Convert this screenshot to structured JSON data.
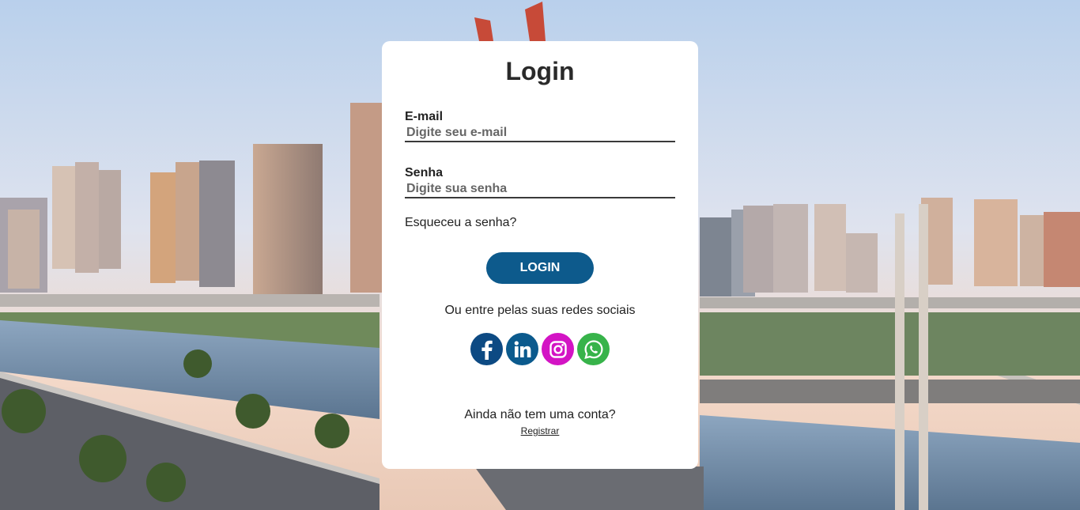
{
  "login": {
    "title": "Login",
    "email_label": "E-mail",
    "email_placeholder": "Digite seu e-mail",
    "password_label": "Senha",
    "password_placeholder": "Digite sua senha",
    "forgot_label": "Esqueceu a senha?",
    "submit_label": "LOGIN",
    "social_text": "Ou entre pelas suas redes sociais",
    "social": [
      {
        "icon": "facebook-icon",
        "color": "#0d4a83"
      },
      {
        "icon": "linkedin-icon",
        "color": "#0b5a8d"
      },
      {
        "icon": "instagram-icon",
        "color": "#d314c4"
      },
      {
        "icon": "whatsapp-icon",
        "color": "#37b34a"
      }
    ],
    "no_account_text": "Ainda não tem uma conta?",
    "register_label": "Registrar"
  },
  "colors": {
    "primary": "#0d5a8c",
    "card": "#ffffff"
  }
}
